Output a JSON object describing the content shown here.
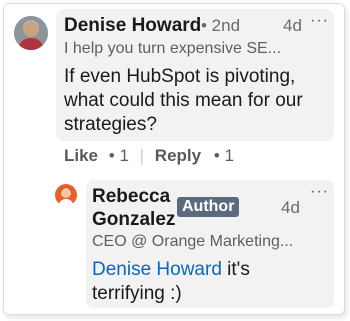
{
  "comment": {
    "author_name": "Denise Howard",
    "degree": "• 2nd",
    "time": "4d",
    "more_label": "···",
    "headline": "I help you turn expensive SE...",
    "text_line1": "If even HubSpot is pivoting,",
    "text_line2": "what could this mean for our",
    "text_line3": "strategies?",
    "like_label": "Like",
    "like_count": "• 1",
    "reply_label": "Reply",
    "reply_count": "• 1"
  },
  "reply": {
    "author_first": "Rebecca",
    "author_last": "Gonzalez",
    "badge": "Author",
    "time": "4d",
    "more_label": "···",
    "headline": "CEO @ Orange Marketing...",
    "mention": "Denise Howard",
    "text_after_mention": " it's",
    "text_line2": "terrifying :)"
  },
  "colors": {
    "mention": "#0a66c2",
    "badge_bg": "#5b6b7e",
    "bubble_bg": "#f2f2f2"
  },
  "icons": {
    "comment_avatar": "avatar-photo",
    "reply_avatar": "avatar-photo",
    "more": "more-horizontal-icon"
  }
}
